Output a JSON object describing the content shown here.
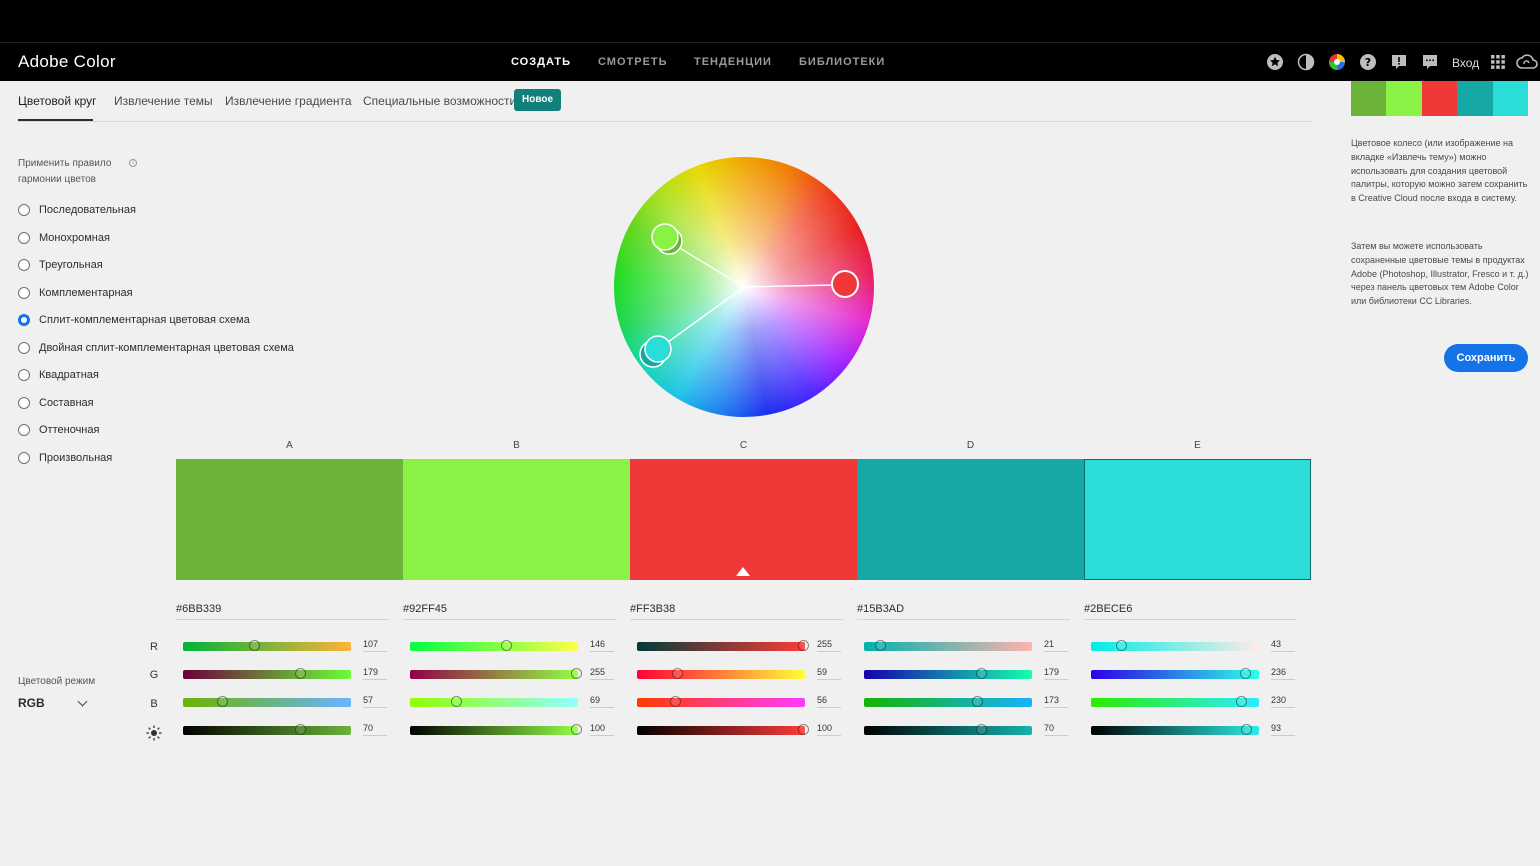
{
  "app": {
    "title": "Adobe Color"
  },
  "nav": {
    "items": [
      "СОЗДАТЬ",
      "СМОТРЕТЬ",
      "ТЕНДЕНЦИИ",
      "БИБЛИОТЕКИ"
    ],
    "login": "Вход"
  },
  "tabs": {
    "items": [
      "Цветовой круг",
      "Извлечение темы",
      "Извлечение градиента",
      "Специальные возможности"
    ],
    "badge": "Новое"
  },
  "harmony": {
    "label": "Применить правило гармонии цветов",
    "options": [
      "Последовательная",
      "Монохромная",
      "Треугольная",
      "Комплементарная",
      "Сплит-комплементарная цветовая схема",
      "Двойная сплит-комплементарная цветовая схема",
      "Квадратная",
      "Составная",
      "Оттеночная",
      "Произвольная"
    ],
    "selected_index": 4
  },
  "color_mode": {
    "label": "Цветовой режим",
    "value": "RGB"
  },
  "channels": [
    "R",
    "G",
    "B"
  ],
  "swatches": [
    {
      "letter": "A",
      "hex": "#6BB339",
      "color": "#6BB339",
      "values": [
        "107",
        "179",
        "57",
        "70"
      ]
    },
    {
      "letter": "B",
      "hex": "#92FF45",
      "color": "#8AF244",
      "values": [
        "146",
        "255",
        "69",
        "100"
      ]
    },
    {
      "letter": "C",
      "hex": "#FF3B38",
      "color": "#F13838",
      "values": [
        "255",
        "59",
        "56",
        "100"
      ]
    },
    {
      "letter": "D",
      "hex": "#15B3AD",
      "color": "#16A8A4",
      "values": [
        "21",
        "179",
        "173",
        "70"
      ]
    },
    {
      "letter": "E",
      "hex": "#2BECE6",
      "color": "#2ADDD6",
      "values": [
        "43",
        "236",
        "230",
        "93"
      ]
    }
  ],
  "selected_swatch": 2,
  "sidebar": {
    "text1": "Цветовое колесо (или изображение на вкладке «Извлечь тему») можно использовать для создания цветовой палитры, которую можно затем сохранить в Creative Cloud после входа в систему.",
    "text2": "Затем вы можете использовать сохраненные цветовые темы в продуктах Adobe (Photoshop, Illustrator, Fresco и т. д.) через панель цветовых тем Adobe Color или библиотеки CC Libraries.",
    "save_label": "Сохранить"
  },
  "icons": [
    "star-icon",
    "contrast-icon",
    "color-wheel-icon",
    "help-icon",
    "alert-icon",
    "chat-icon",
    "apps-grid-icon",
    "creative-cloud-icon",
    "info-icon",
    "brightness-icon",
    "chevron-down-icon"
  ]
}
